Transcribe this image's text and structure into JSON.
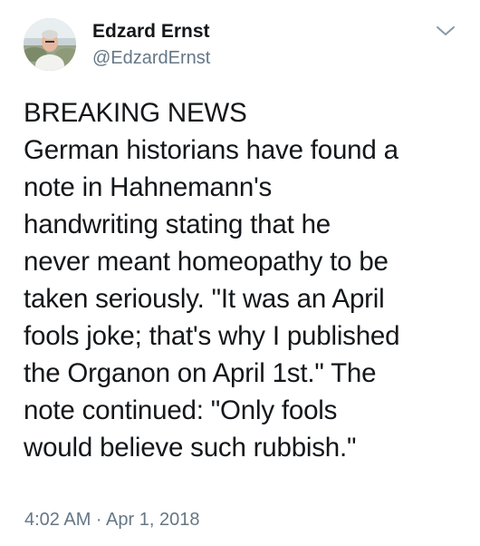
{
  "author": {
    "name": "Edzard Ernst",
    "handle": "@EdzardErnst",
    "avatar_icon": "profile-photo"
  },
  "menu_icon": "chevron-down-icon",
  "tweet": {
    "lines": [
      "BREAKING NEWS",
      "German historians have found a",
      "note in Hahnemann's",
      "handwriting stating that he",
      "never meant homeopathy to be",
      "taken seriously. \"It was an April",
      "fools joke; that's why I published",
      "the Organon on April 1st.\" The",
      "note continued: \"Only fools",
      "would believe such rubbish.\""
    ],
    "timestamp": "4:02 AM · Apr 1, 2018"
  },
  "colors": {
    "text_primary": "#14171a",
    "text_secondary": "#657786",
    "background": "#ffffff"
  }
}
